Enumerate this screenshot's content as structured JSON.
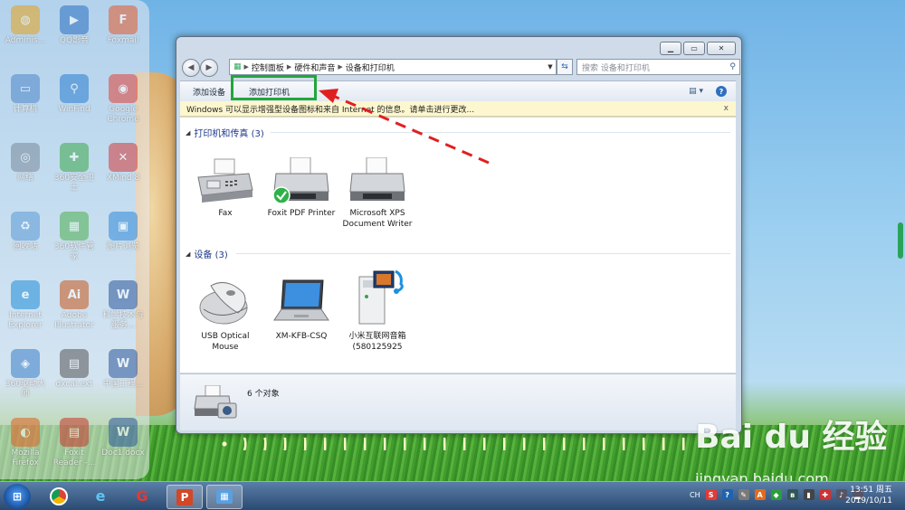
{
  "desktop": {
    "icons": [
      {
        "label": "Adminis..."
      },
      {
        "label": "QQ影音"
      },
      {
        "label": "Foxmail"
      },
      {
        "label": "计算机"
      },
      {
        "label": "WinFind"
      },
      {
        "label": "Google Chrome"
      },
      {
        "label": "网络"
      },
      {
        "label": "360安全卫士"
      },
      {
        "label": "XMind 8"
      },
      {
        "label": "回收站"
      },
      {
        "label": "360软件管家"
      },
      {
        "label": "图片浏览"
      },
      {
        "label": "Internet Explorer"
      },
      {
        "label": "Adobe Illustrator"
      },
      {
        "label": "科学技术与服务..."
      },
      {
        "label": "360驱动大师"
      },
      {
        "label": "dxcal.ext"
      },
      {
        "label": "中国工程..."
      },
      {
        "label": "Mozilla Firefox"
      },
      {
        "label": "Foxit Reader -..."
      },
      {
        "label": "Doc1.docx"
      }
    ]
  },
  "window": {
    "address": {
      "crumbs": [
        "控制面板",
        "硬件和声音",
        "设备和打印机"
      ]
    },
    "search_placeholder": "搜索 设备和打印机",
    "toolbar": {
      "add_device": "添加设备",
      "add_printer": "添加打印机"
    },
    "infobar": {
      "text": "Windows 可以显示增强型设备图标和来自 Internet 的信息。请单击进行更改...",
      "close": "x"
    },
    "groups": [
      {
        "title": "打印机和传真 (3)",
        "items": [
          {
            "label": "Fax"
          },
          {
            "label": "Foxit PDF Printer",
            "default": true
          },
          {
            "label": "Microsoft XPS Document Writer"
          }
        ]
      },
      {
        "title": "设备 (3)",
        "items": [
          {
            "label": "USB Optical Mouse"
          },
          {
            "label": "XM-KFB-CSQ"
          },
          {
            "label": "小米互联网音箱 (580125925"
          }
        ]
      }
    ],
    "details": {
      "count": "6 个对象"
    }
  },
  "taskbar": {
    "tray_lang": "CH",
    "time": "13:51 周五",
    "date": "2019/10/11"
  },
  "watermark": {
    "brand": "Bai du 经验",
    "url": "jingyan.baidu.com"
  },
  "colors": {
    "highlight": "#22a63a",
    "arrow": "#e02020",
    "group_title": "#1e3a8c"
  }
}
